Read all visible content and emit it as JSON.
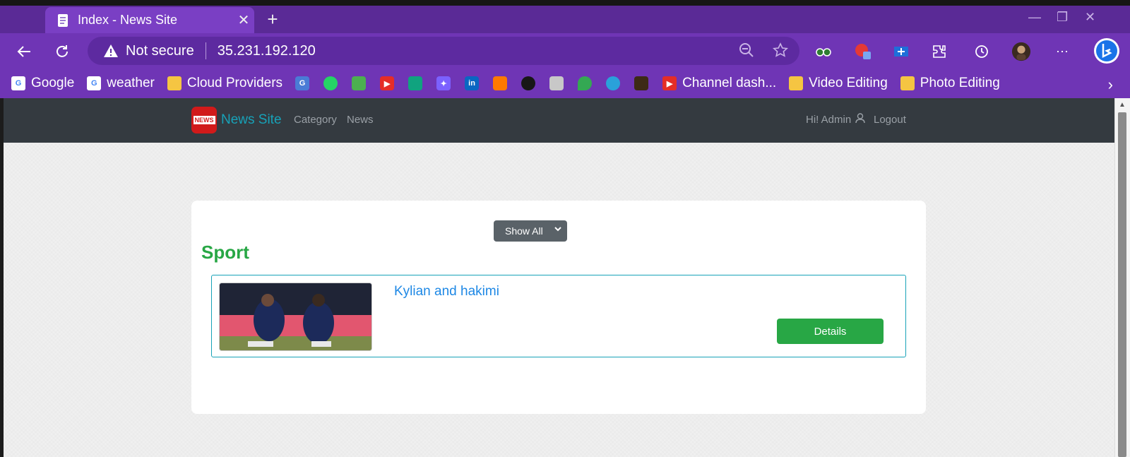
{
  "browser": {
    "tab_title": "Index - News Site",
    "tab_close": "✕",
    "new_tab": "+",
    "security_label": "Not secure",
    "url": "35.231.192.120",
    "bookmarks": [
      {
        "label": "Google"
      },
      {
        "label": "weather"
      },
      {
        "label": "Cloud Providers"
      },
      {
        "label": "Channel dash..."
      },
      {
        "label": "Video Editing"
      },
      {
        "label": "Photo Editing"
      }
    ]
  },
  "site": {
    "brand_logo_text": "NEWS",
    "brand_name": "News Site",
    "nav": {
      "category": "Category",
      "news": "News",
      "greeting": "Hi! Admin",
      "logout": "Logout"
    },
    "filter": {
      "selected": "Show All"
    },
    "section_heading": "Sport",
    "articles": [
      {
        "title": "Kylian and hakimi",
        "button": "Details"
      }
    ]
  },
  "colors": {
    "browser_purple": "#6f35b5",
    "navbar": "#343a40",
    "brand": "#17a2b8",
    "heading_green": "#28a745",
    "link_blue": "#1e88e5",
    "button_green": "#28a745"
  }
}
